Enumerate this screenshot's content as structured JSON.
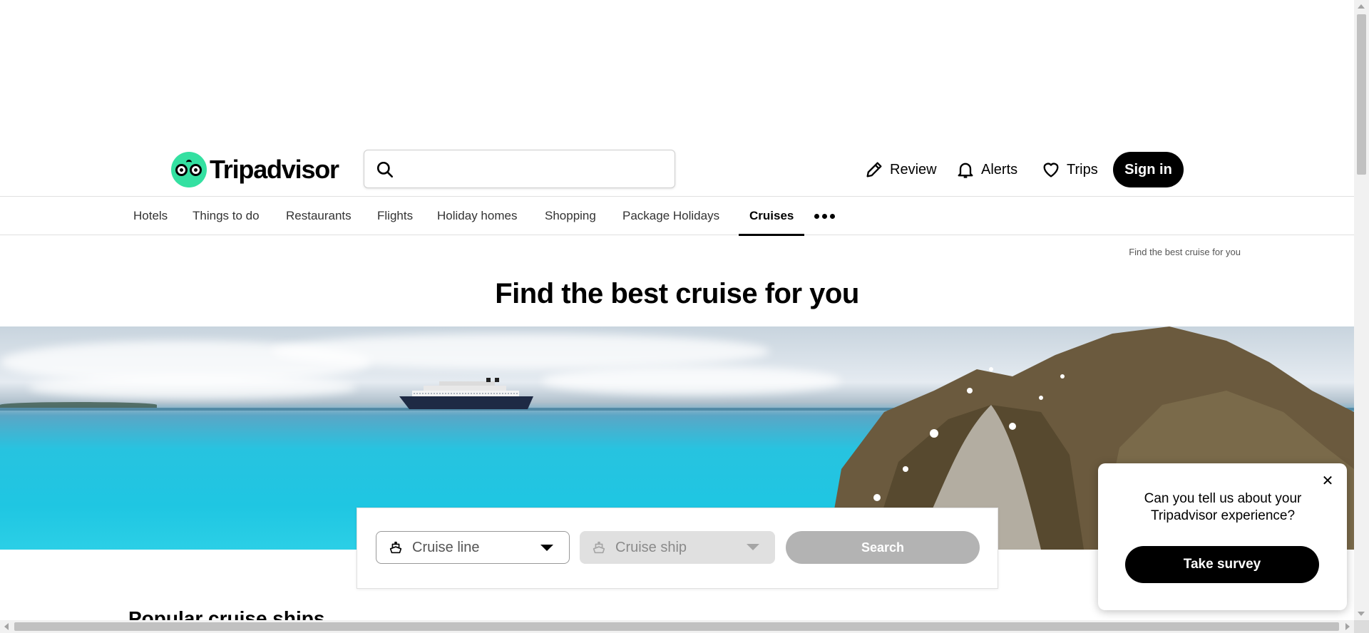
{
  "header": {
    "logo_text": "Tripadvisor",
    "search_placeholder": "",
    "review_label": "Review",
    "alerts_label": "Alerts",
    "trips_label": "Trips",
    "signin_label": "Sign in"
  },
  "nav": {
    "items": [
      {
        "label": "Hotels"
      },
      {
        "label": "Things to do"
      },
      {
        "label": "Restaurants"
      },
      {
        "label": "Flights"
      },
      {
        "label": "Holiday homes"
      },
      {
        "label": "Shopping"
      },
      {
        "label": "Package Holidays"
      },
      {
        "label": "Cruises",
        "active": true
      }
    ],
    "more_icon": "more-dots-icon"
  },
  "breadcrumb": "Find the best cruise for you",
  "page_title": "Find the best cruise for you",
  "cruise_search": {
    "cruise_line_placeholder": "Cruise line",
    "cruise_ship_placeholder": "Cruise ship",
    "search_label": "Search"
  },
  "section_heading": "Popular cruise ships",
  "survey": {
    "question": "Can you tell us about your Tripadvisor experience?",
    "button_label": "Take survey",
    "close_icon": "close-icon"
  },
  "colors": {
    "brand_green": "#34e0a1",
    "primary_black": "#000000",
    "disabled_gray": "#b3b3b3"
  }
}
